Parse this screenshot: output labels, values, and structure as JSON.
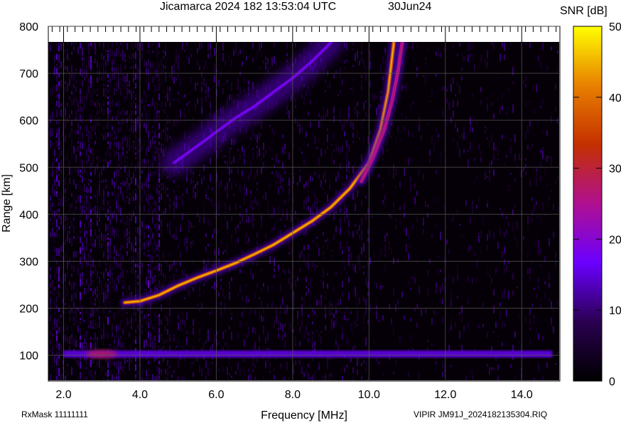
{
  "header": {
    "title": "Jicamarca 2024 182 13:53:04 UTC",
    "date": "30Jun24"
  },
  "footer": {
    "rx_mask": "RxMask 11111111",
    "file": "VIPIR  JM91J_2024182135304.RIQ"
  },
  "colorbar": {
    "title": "SNR [dB]",
    "range": [
      0,
      50
    ],
    "ticks": [
      "0",
      "10",
      "20",
      "30",
      "40",
      "50"
    ],
    "colors": [
      "#000000",
      "#2a0050",
      "#6a00ff",
      "#b01090",
      "#c43000",
      "#e88000",
      "#ffff00"
    ]
  },
  "chart_data": {
    "type": "heatmap",
    "title": "Jicamarca 2024 182 13:53:04 UTC",
    "subtitle": "30Jun24",
    "xlabel": "Frequency [MHz]",
    "ylabel": "Range [km]",
    "xlim": [
      1.6,
      15.0
    ],
    "ylim": [
      45,
      800
    ],
    "x_ticks": [
      "2.0",
      "4.0",
      "6.0",
      "8.0",
      "10.0",
      "12.0",
      "14.0"
    ],
    "y_ticks": [
      "100",
      "200",
      "300",
      "400",
      "500",
      "600",
      "700",
      "800"
    ],
    "grid": true,
    "colorbar_label": "SNR [dB]",
    "colorbar_range": [
      0,
      50
    ],
    "data_ceiling_km": 765,
    "features": [
      {
        "name": "E-layer echo",
        "freq_range_mhz": [
          2.0,
          14.8
        ],
        "range_km": [
          95,
          110
        ],
        "snr_db": 16
      },
      {
        "name": "F-layer trace (O-mode)",
        "snr_db": 38,
        "points": [
          [
            3.6,
            212
          ],
          [
            4.0,
            215
          ],
          [
            4.5,
            228
          ],
          [
            5.0,
            248
          ],
          [
            5.5,
            265
          ],
          [
            6.0,
            280
          ],
          [
            6.5,
            296
          ],
          [
            7.0,
            315
          ],
          [
            7.5,
            335
          ],
          [
            8.0,
            360
          ],
          [
            8.5,
            385
          ],
          [
            9.0,
            415
          ],
          [
            9.5,
            455
          ],
          [
            10.0,
            510
          ],
          [
            10.3,
            580
          ],
          [
            10.5,
            660
          ],
          [
            10.65,
            765
          ]
        ]
      },
      {
        "name": "F-layer trace (X-mode)",
        "snr_db": 26,
        "points": [
          [
            9.8,
            470
          ],
          [
            10.1,
            520
          ],
          [
            10.4,
            580
          ],
          [
            10.6,
            640
          ],
          [
            10.75,
            700
          ],
          [
            10.87,
            765
          ]
        ]
      },
      {
        "name": "Multiple-hop echo",
        "snr_db": 18,
        "points": [
          [
            4.9,
            510
          ],
          [
            5.5,
            545
          ],
          [
            6.0,
            575
          ],
          [
            6.5,
            605
          ],
          [
            7.0,
            630
          ],
          [
            7.5,
            660
          ],
          [
            8.0,
            690
          ],
          [
            8.5,
            725
          ],
          [
            9.0,
            765
          ]
        ]
      }
    ]
  }
}
